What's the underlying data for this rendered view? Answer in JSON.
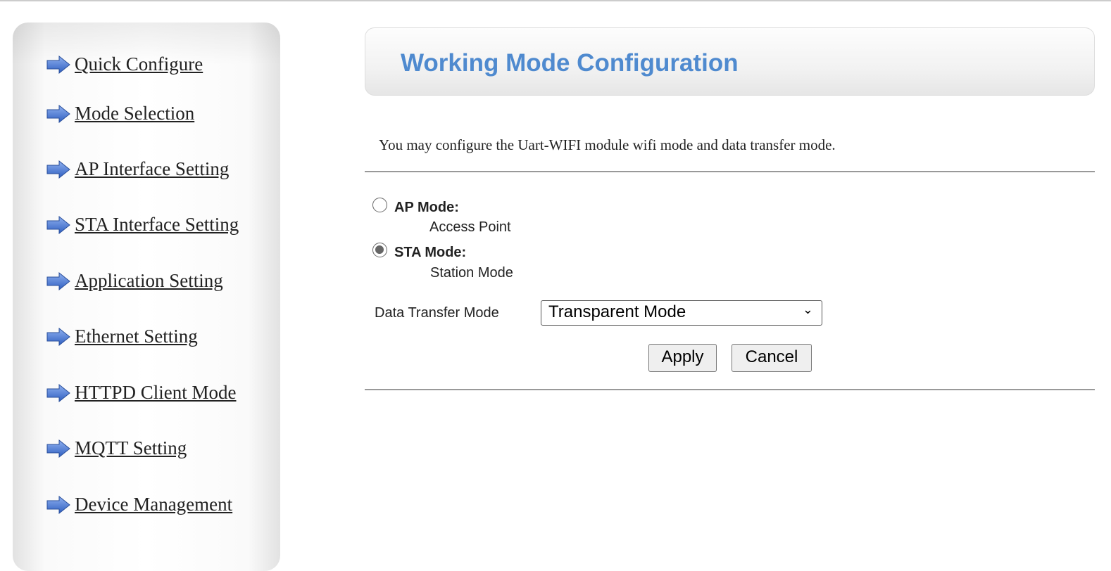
{
  "sidebar": {
    "items": [
      {
        "label": "Quick Configure"
      },
      {
        "label": "Mode Selection"
      },
      {
        "label": "AP Interface Setting"
      },
      {
        "label": "STA Interface Setting"
      },
      {
        "label": "Application Setting"
      },
      {
        "label": "Ethernet Setting"
      },
      {
        "label": "HTTPD Client Mode"
      },
      {
        "label": "MQTT Setting"
      },
      {
        "label": "Device Management"
      }
    ],
    "icon": "arrow-right-icon"
  },
  "header": {
    "title": "Working Mode Configuration",
    "title_color": "#4f8acf"
  },
  "description": "You may configure the Uart-WIFI module wifi mode and data transfer mode.",
  "modes": [
    {
      "label": "AP Mode:",
      "desc": "Access Point",
      "checked": false
    },
    {
      "label": "STA Mode:",
      "desc": "Station Mode",
      "checked": true
    }
  ],
  "transfer": {
    "label": "Data Transfer Mode",
    "value": "Transparent Mode"
  },
  "buttons": {
    "apply": "Apply",
    "cancel": "Cancel"
  }
}
